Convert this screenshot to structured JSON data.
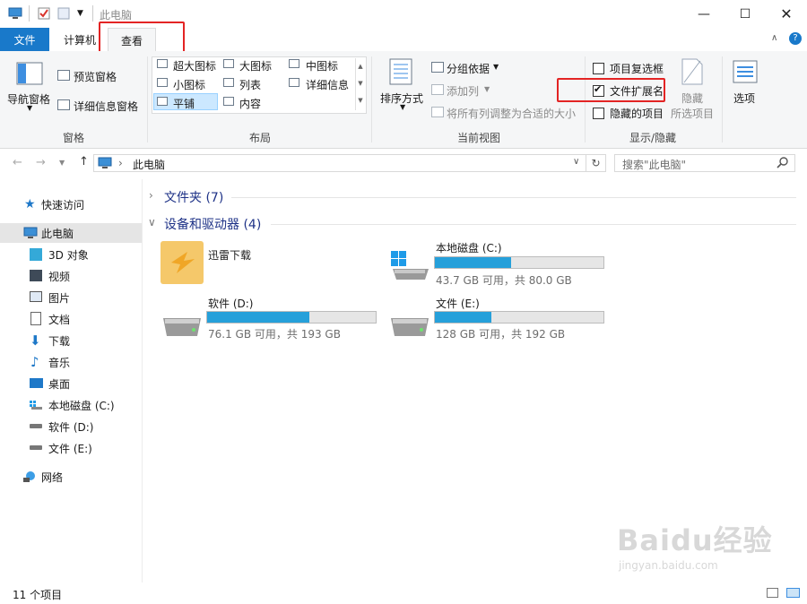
{
  "window": {
    "title": "此电脑",
    "controls": [
      "minimize-icon",
      "maximize-icon",
      "close-icon"
    ]
  },
  "tabs": {
    "file": "文件",
    "computer": "计算机",
    "view": "查看"
  },
  "ribbon": {
    "panes": {
      "nav_pane": "导航窗格",
      "preview_pane": "预览窗格",
      "details_pane": "详细信息窗格",
      "group": "窗格"
    },
    "layout": {
      "items": [
        "超大图标",
        "大图标",
        "中图标",
        "小图标",
        "列表",
        "详细信息",
        "平铺",
        "内容"
      ],
      "selected": "平铺",
      "group": "布局"
    },
    "current_view": {
      "sort_by": "排序方式",
      "group_by": "分组依据",
      "add_column": "添加列",
      "fit_columns": "将所有列调整为合适的大小",
      "group": "当前视图"
    },
    "show_hide": {
      "item_checkboxes": {
        "label": "项目复选框",
        "checked": false
      },
      "file_extensions": {
        "label": "文件扩展名",
        "checked": true
      },
      "hidden_items": {
        "label": "隐藏的项目",
        "checked": false
      },
      "hide": "隐藏",
      "hide_selected": "所选项目",
      "group": "显示/隐藏"
    },
    "options": "选项"
  },
  "address": {
    "path": "此电脑",
    "search_placeholder": "搜索\"此电脑\""
  },
  "nav": {
    "quick_access": "快速访问",
    "this_pc": "此电脑",
    "items": [
      "3D 对象",
      "视频",
      "图片",
      "文档",
      "下载",
      "音乐",
      "桌面",
      "本地磁盘 (C:)",
      "软件 (D:)",
      "文件 (E:)"
    ],
    "network": "网络"
  },
  "content": {
    "folders_header": "文件夹 (7)",
    "devices_header": "设备和驱动器 (4)",
    "thunder": "迅雷下载",
    "drives": [
      {
        "name": "本地磁盘 (C:)",
        "stat": "43.7 GB 可用，共 80.0 GB",
        "used_fraction": 0.454
      },
      {
        "name": "软件 (D:)",
        "stat": "76.1 GB 可用，共 193 GB",
        "used_fraction": 0.606
      },
      {
        "name": "文件 (E:)",
        "stat": "128 GB 可用，共 192 GB",
        "used_fraction": 0.333
      }
    ]
  },
  "status": {
    "count": "11 个项目"
  },
  "watermark": {
    "brand": "Baidu经验",
    "url": "jingyan.baidu.com"
  }
}
